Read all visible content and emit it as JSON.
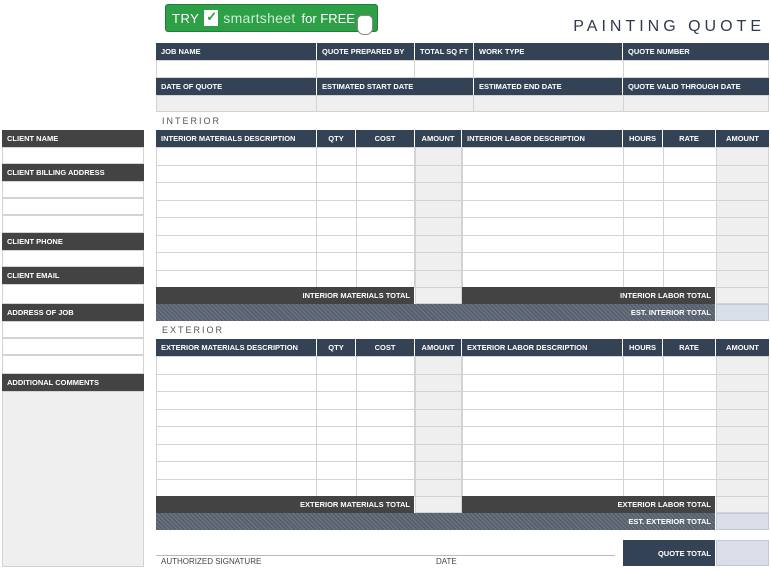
{
  "banner": {
    "try": "TRY",
    "brand": "smartsheet",
    "free": "for FREE"
  },
  "title": "PAINTING QUOTE",
  "top_fields": {
    "row1": [
      "JOB NAME",
      "QUOTE PREPARED BY",
      "TOTAL SQ FT",
      "WORK TYPE",
      "QUOTE NUMBER"
    ],
    "row2": [
      "DATE OF QUOTE",
      "ESTIMATED START DATE",
      "ESTIMATED END DATE",
      "QUOTE VALID THROUGH DATE"
    ]
  },
  "client": {
    "name": "CLIENT NAME",
    "billing": "CLIENT BILLING ADDRESS",
    "phone": "CLIENT PHONE",
    "email": "CLIENT EMAIL",
    "job_address": "ADDRESS OF JOB",
    "comments": "ADDITIONAL COMMENTS"
  },
  "interior": {
    "section": "INTERIOR",
    "materials_headers": [
      "INTERIOR MATERIALS DESCRIPTION",
      "QTY",
      "COST",
      "AMOUNT"
    ],
    "labor_headers": [
      "INTERIOR LABOR DESCRIPTION",
      "HOURS",
      "RATE",
      "AMOUNT"
    ],
    "materials_total": "INTERIOR MATERIALS TOTAL",
    "labor_total": "INTERIOR LABOR TOTAL",
    "est_total": "EST. INTERIOR TOTAL"
  },
  "exterior": {
    "section": "EXTERIOR",
    "materials_headers": [
      "EXTERIOR MATERIALS DESCRIPTION",
      "QTY",
      "COST",
      "AMOUNT"
    ],
    "labor_headers": [
      "EXTERIOR LABOR DESCRIPTION",
      "HOURS",
      "RATE",
      "AMOUNT"
    ],
    "materials_total": "EXTERIOR MATERIALS TOTAL",
    "labor_total": "EXTERIOR LABOR TOTAL",
    "est_total": "EST. EXTERIOR TOTAL"
  },
  "footer": {
    "signature": "AUTHORIZED SIGNATURE",
    "date": "DATE",
    "quote_total": "QUOTE TOTAL"
  },
  "colors": {
    "header": "#344256",
    "dark": "#434343",
    "accent": "#2d9f46",
    "total_cell": "#d9dee8"
  }
}
